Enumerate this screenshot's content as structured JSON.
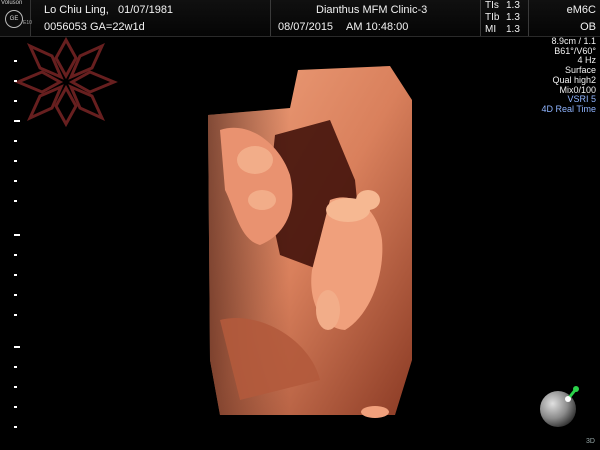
{
  "header": {
    "brand": "Voluson",
    "logo": "GE",
    "model": "E10",
    "patient_name": "Lo Chiu Ling,",
    "dob": "01/07/1981",
    "patient_id": "0056053",
    "ga": "GA=22w1d",
    "clinic": "Dianthus MFM Clinic-3",
    "exam_date": "08/07/2015",
    "exam_time": "AM 10:48:00",
    "safety": [
      {
        "label": "TIs",
        "value": "1.3"
      },
      {
        "label": "TIb",
        "value": "1.3"
      },
      {
        "label": "MI",
        "value": "1.3"
      }
    ],
    "probe": "eM6C",
    "preset": "OB"
  },
  "params": {
    "depth": "8.9cm / 1.1",
    "angle": "B61°/V60°",
    "rate": "4 Hz",
    "render_mode": "Surface",
    "quality": "Qual high2",
    "mix": "Mix0/100",
    "vsri": "VSRI 5",
    "mode": "4D Real Time"
  },
  "footer": {
    "mode_label": "3D"
  },
  "colors": {
    "background": "#000000",
    "param_accent": "#8fb4ff",
    "render_skin": "#d9805c",
    "watermark": "#8a2a2a"
  },
  "icons": {
    "watermark": "starburst-watermark-icon",
    "orientation": "orientation-ball-icon"
  }
}
